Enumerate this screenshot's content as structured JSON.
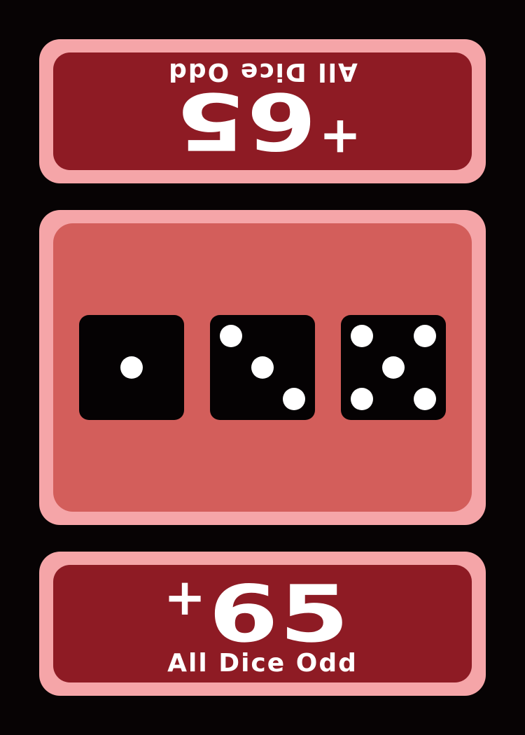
{
  "card": {
    "top": {
      "plus": "+",
      "points": "65",
      "label": "All Dice Odd"
    },
    "bottom": {
      "plus": "+",
      "points": "65",
      "label": "All Dice Odd"
    },
    "dice": [
      {
        "value": 1
      },
      {
        "value": 3
      },
      {
        "value": 5
      }
    ],
    "colors": {
      "background": "#070304",
      "panel_border": "#f5a5a8",
      "score_panel": "#8e1b24",
      "dice_panel": "#d35e5b",
      "die": "#050203",
      "pip": "#ffffff"
    }
  }
}
